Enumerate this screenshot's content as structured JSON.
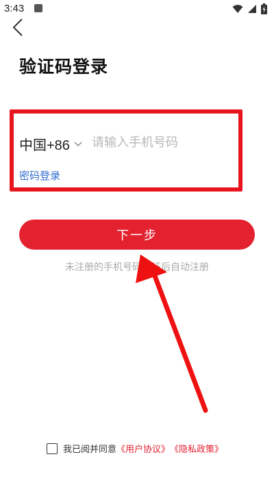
{
  "status_bar": {
    "time": "3:43"
  },
  "header": {
    "title": "验证码登录"
  },
  "form": {
    "country_code": "中国+86",
    "phone_placeholder": "请输入手机号码",
    "password_login_link": "密码登录",
    "next_button": "下一步",
    "hint": "未注册的手机号码验证后自动注册"
  },
  "agreement": {
    "prefix": "我已阅并同意",
    "user_agreement": "《用户协议》",
    "privacy_policy": "《隐私政策》"
  },
  "colors": {
    "accent": "#e3212f",
    "annotation_red": "#e8141e",
    "link_blue": "#2f6dcc"
  },
  "icons": [
    "back-arrow-icon",
    "chevron-down-icon",
    "wifi-icon",
    "cellular-signal-icon",
    "battery-icon"
  ]
}
